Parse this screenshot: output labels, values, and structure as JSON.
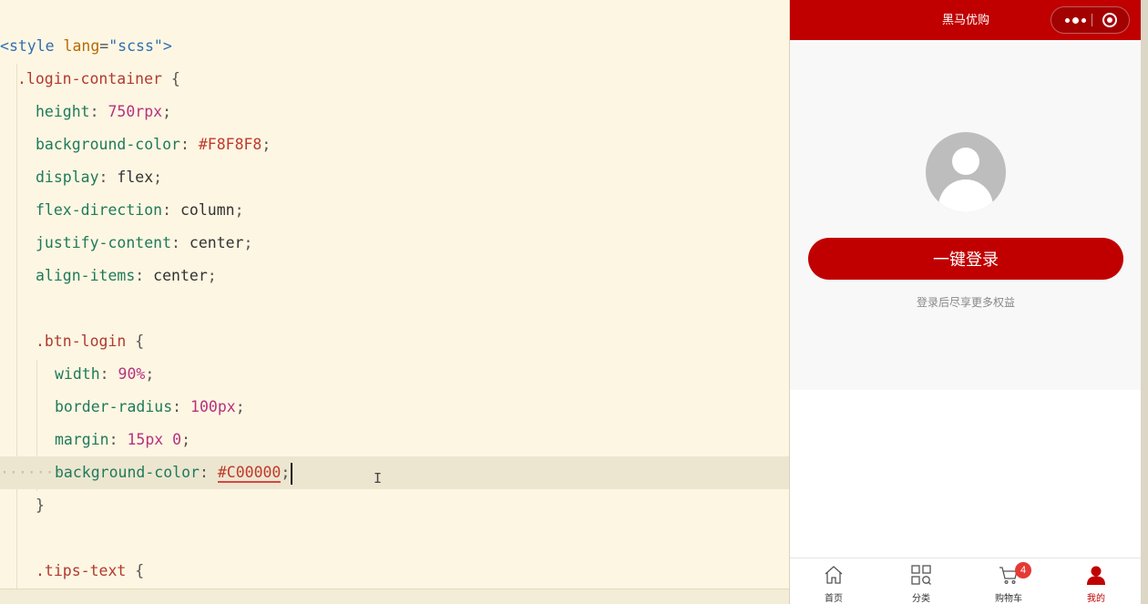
{
  "editor": {
    "lines": {
      "l1": {
        "open": "<",
        "tag": "style",
        "attr": "lang",
        "eq": "=",
        "str": "\"scss\"",
        "close": ">"
      },
      "l2": {
        "sel": ".login-container",
        "brace": " {"
      },
      "l3": {
        "prop": "height",
        "colon": ": ",
        "num": "750",
        "unit": "rpx",
        "semi": ";"
      },
      "l4": {
        "prop": "background-color",
        "colon": ": ",
        "hex": "#F8F8F8",
        "semi": ";"
      },
      "l5": {
        "prop": "display",
        "colon": ": ",
        "val": "flex",
        "semi": ";"
      },
      "l6": {
        "prop": "flex-direction",
        "colon": ": ",
        "val": "column",
        "semi": ";"
      },
      "l7": {
        "prop": "justify-content",
        "colon": ": ",
        "val": "center",
        "semi": ";"
      },
      "l8": {
        "prop": "align-items",
        "colon": ": ",
        "val": "center",
        "semi": ";"
      },
      "l10": {
        "sel": ".btn-login",
        "brace": " {"
      },
      "l11": {
        "prop": "width",
        "colon": ": ",
        "num": "90",
        "unit": "%",
        "semi": ";"
      },
      "l12": {
        "prop": "border-radius",
        "colon": ": ",
        "num": "100",
        "unit": "px",
        "semi": ";"
      },
      "l13": {
        "prop": "margin",
        "colon": ": ",
        "num": "15",
        "unit": "px",
        "num2": "0",
        "semi": ";"
      },
      "l14": {
        "prop": "background-color",
        "colon": ": ",
        "hex": "#C00000",
        "semi": ";"
      },
      "l15": {
        "brace": "}"
      },
      "l17": {
        "sel": ".tips-text",
        "brace": " {"
      }
    }
  },
  "phone": {
    "nav_title": "黑马优购",
    "login_button": "一键登录",
    "tips_text": "登录后尽享更多权益",
    "colors": {
      "nav": "#C00000",
      "container_bg": "#F8F8F8",
      "button": "#C00000"
    },
    "tabs": [
      {
        "label": "首页",
        "icon": "home-icon"
      },
      {
        "label": "分类",
        "icon": "category-icon"
      },
      {
        "label": "购物车",
        "icon": "cart-icon",
        "badge": "4"
      },
      {
        "label": "我的",
        "icon": "user-icon",
        "active": true
      }
    ]
  }
}
